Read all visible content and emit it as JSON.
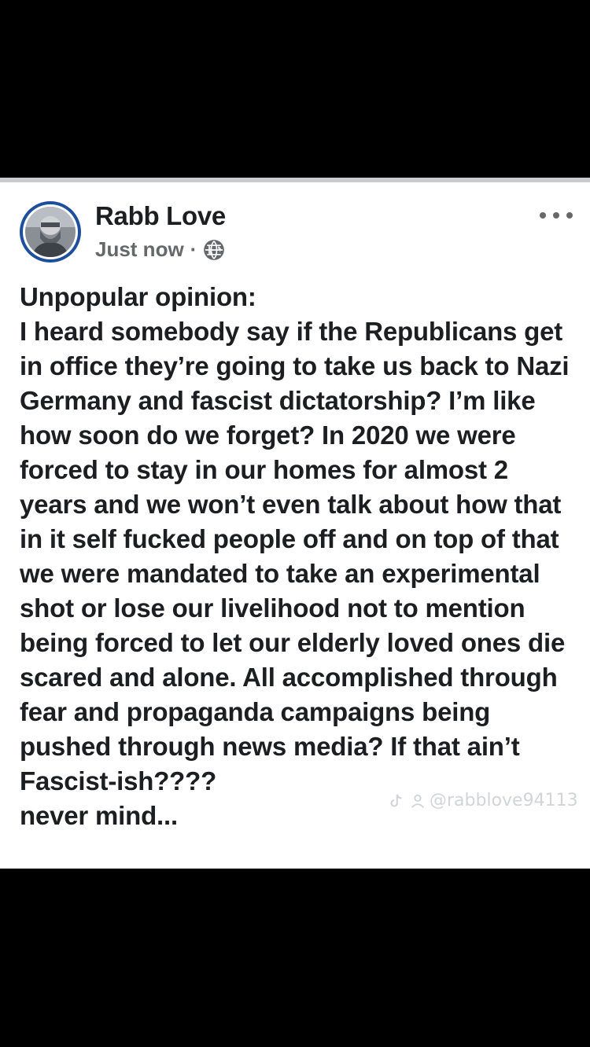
{
  "post": {
    "author_name": "Rabb Love",
    "timestamp": "Just now",
    "meta_separator": "·",
    "audience_icon": "globe-icon",
    "more_icon": "more-horizontal-icon",
    "text": "Unpopular opinion:\nI heard somebody say if the Republicans get in office they’re going to take us back to Nazi Germany and fascist dictatorship? I’m like how soon do we forget? In 2020 we were forced to stay in our homes for almost 2 years and we won’t even talk about how that in it self fucked people off and on top of that we were mandated to take an experimental shot or lose our livelihood not to mention being forced to let our elderly loved ones die scared and alone. All accomplished through fear and propaganda campaigns being pushed through news media? If that ain’t Fascist-ish????\nnever mind..."
  },
  "watermark": {
    "handle": "@rabblove94113"
  },
  "colors": {
    "text_primary": "#1c1e21",
    "text_secondary": "#65676b",
    "avatar_ring": "#1d4f9c",
    "background_band": "#000000",
    "card": "#ffffff"
  }
}
